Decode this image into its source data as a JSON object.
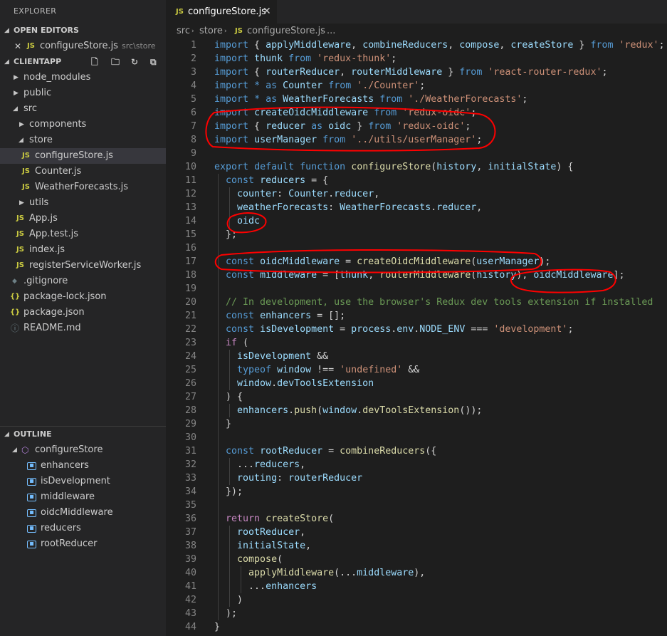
{
  "explorer": {
    "title": "EXPLORER",
    "open_editors": {
      "header": "OPEN EDITORS",
      "items": [
        {
          "close_glyph": "✕",
          "badge": "JS",
          "name": "configureStore.js",
          "path": "src\\store"
        }
      ]
    },
    "project": {
      "header": "CLIENTAPP",
      "tree": [
        {
          "label": "node_modules",
          "badge": ""
        },
        {
          "label": "public",
          "badge": ""
        },
        {
          "label": "src",
          "badge": ""
        },
        {
          "label": "components",
          "badge": ""
        },
        {
          "label": "store",
          "badge": ""
        },
        {
          "label": "configureStore.js",
          "badge": "JS"
        },
        {
          "label": "Counter.js",
          "badge": "JS"
        },
        {
          "label": "WeatherForecasts.js",
          "badge": "JS"
        },
        {
          "label": "utils",
          "badge": ""
        },
        {
          "label": "App.js",
          "badge": "JS"
        },
        {
          "label": "App.test.js",
          "badge": "JS"
        },
        {
          "label": "index.js",
          "badge": "JS"
        },
        {
          "label": "registerServiceWorker.js",
          "badge": "JS"
        },
        {
          "label": ".gitignore",
          "badge": "◆"
        },
        {
          "label": "package-lock.json",
          "badge": "{}"
        },
        {
          "label": "package.json",
          "badge": "{}"
        },
        {
          "label": "README.md",
          "badge": "ⓘ"
        }
      ]
    },
    "outline": {
      "header": "OUTLINE",
      "root": "configureStore",
      "items": [
        "enhancers",
        "isDevelopment",
        "middleware",
        "oidcMiddleware",
        "reducers",
        "rootReducer"
      ]
    }
  },
  "editor": {
    "tab": {
      "badge": "JS",
      "label": "configureStore.js",
      "close_glyph": "✕"
    },
    "breadcrumb": {
      "parts": [
        "src",
        "store",
        "configureStore.js",
        "..."
      ],
      "badge": "JS"
    },
    "code_lines": [
      [
        [
          "kw",
          "import"
        ],
        [
          "pl",
          " { "
        ],
        [
          "var",
          "applyMiddleware"
        ],
        [
          "pl",
          ", "
        ],
        [
          "var",
          "combineReducers"
        ],
        [
          "pl",
          ", "
        ],
        [
          "var",
          "compose"
        ],
        [
          "pl",
          ", "
        ],
        [
          "var",
          "createStore"
        ],
        [
          "pl",
          " } "
        ],
        [
          "kw",
          "from"
        ],
        [
          "pl",
          " "
        ],
        [
          "str",
          "'redux'"
        ],
        [
          "pl",
          ";"
        ]
      ],
      [
        [
          "kw",
          "import"
        ],
        [
          "pl",
          " "
        ],
        [
          "var",
          "thunk"
        ],
        [
          "pl",
          " "
        ],
        [
          "kw",
          "from"
        ],
        [
          "pl",
          " "
        ],
        [
          "str",
          "'redux-thunk'"
        ],
        [
          "pl",
          ";"
        ]
      ],
      [
        [
          "kw",
          "import"
        ],
        [
          "pl",
          " { "
        ],
        [
          "var",
          "routerReducer"
        ],
        [
          "pl",
          ", "
        ],
        [
          "var",
          "routerMiddleware"
        ],
        [
          "pl",
          " } "
        ],
        [
          "kw",
          "from"
        ],
        [
          "pl",
          " "
        ],
        [
          "str",
          "'react-router-redux'"
        ],
        [
          "pl",
          ";"
        ]
      ],
      [
        [
          "kw",
          "import"
        ],
        [
          "pl",
          " "
        ],
        [
          "kw",
          "*"
        ],
        [
          "pl",
          " "
        ],
        [
          "kw",
          "as"
        ],
        [
          "pl",
          " "
        ],
        [
          "var",
          "Counter"
        ],
        [
          "pl",
          " "
        ],
        [
          "kw",
          "from"
        ],
        [
          "pl",
          " "
        ],
        [
          "str",
          "'./Counter'"
        ],
        [
          "pl",
          ";"
        ]
      ],
      [
        [
          "kw",
          "import"
        ],
        [
          "pl",
          " "
        ],
        [
          "kw",
          "*"
        ],
        [
          "pl",
          " "
        ],
        [
          "kw",
          "as"
        ],
        [
          "pl",
          " "
        ],
        [
          "var",
          "WeatherForecasts"
        ],
        [
          "pl",
          " "
        ],
        [
          "kw",
          "from"
        ],
        [
          "pl",
          " "
        ],
        [
          "str",
          "'./WeatherForecasts'"
        ],
        [
          "pl",
          ";"
        ]
      ],
      [
        [
          "kw",
          "import"
        ],
        [
          "pl",
          " "
        ],
        [
          "var",
          "createOidcMiddleware"
        ],
        [
          "pl",
          " "
        ],
        [
          "kw",
          "from"
        ],
        [
          "pl",
          " "
        ],
        [
          "str",
          "'redux-oidc'"
        ],
        [
          "pl",
          ";"
        ]
      ],
      [
        [
          "kw",
          "import"
        ],
        [
          "pl",
          " { "
        ],
        [
          "var",
          "reducer"
        ],
        [
          "pl",
          " "
        ],
        [
          "kw",
          "as"
        ],
        [
          "pl",
          " "
        ],
        [
          "var",
          "oidc"
        ],
        [
          "pl",
          " } "
        ],
        [
          "kw",
          "from"
        ],
        [
          "pl",
          " "
        ],
        [
          "str",
          "'redux-oidc'"
        ],
        [
          "pl",
          ";"
        ]
      ],
      [
        [
          "kw",
          "import"
        ],
        [
          "pl",
          " "
        ],
        [
          "var",
          "userManager"
        ],
        [
          "pl",
          " "
        ],
        [
          "kw",
          "from"
        ],
        [
          "pl",
          " "
        ],
        [
          "str",
          "'../utils/userManager'"
        ],
        [
          "pl",
          ";"
        ]
      ],
      [],
      [
        [
          "kw",
          "export"
        ],
        [
          "pl",
          " "
        ],
        [
          "kw",
          "default"
        ],
        [
          "pl",
          " "
        ],
        [
          "kw",
          "function"
        ],
        [
          "pl",
          " "
        ],
        [
          "fn",
          "configureStore"
        ],
        [
          "pl",
          "("
        ],
        [
          "var",
          "history"
        ],
        [
          "pl",
          ", "
        ],
        [
          "var",
          "initialState"
        ],
        [
          "pl",
          ") {"
        ]
      ],
      [
        [
          "pl",
          "  "
        ],
        [
          "kw",
          "const"
        ],
        [
          "pl",
          " "
        ],
        [
          "var",
          "reducers"
        ],
        [
          "pl",
          " = {"
        ]
      ],
      [
        [
          "pl",
          "    "
        ],
        [
          "var",
          "counter"
        ],
        [
          "pl",
          ": "
        ],
        [
          "var",
          "Counter"
        ],
        [
          "pl",
          "."
        ],
        [
          "var",
          "reducer"
        ],
        [
          "pl",
          ","
        ]
      ],
      [
        [
          "pl",
          "    "
        ],
        [
          "var",
          "weatherForecasts"
        ],
        [
          "pl",
          ": "
        ],
        [
          "var",
          "WeatherForecasts"
        ],
        [
          "pl",
          "."
        ],
        [
          "var",
          "reducer"
        ],
        [
          "pl",
          ","
        ]
      ],
      [
        [
          "pl",
          "    "
        ],
        [
          "var",
          "oidc"
        ]
      ],
      [
        [
          "pl",
          "  };"
        ]
      ],
      [],
      [
        [
          "pl",
          "  "
        ],
        [
          "kw",
          "const"
        ],
        [
          "pl",
          " "
        ],
        [
          "var",
          "oidcMiddleware"
        ],
        [
          "pl",
          " = "
        ],
        [
          "fn",
          "createOidcMiddleware"
        ],
        [
          "pl",
          "("
        ],
        [
          "var",
          "userManager"
        ],
        [
          "pl",
          ");"
        ]
      ],
      [
        [
          "pl",
          "  "
        ],
        [
          "kw",
          "const"
        ],
        [
          "pl",
          " "
        ],
        [
          "var",
          "middleware"
        ],
        [
          "pl",
          " = ["
        ],
        [
          "var",
          "thunk"
        ],
        [
          "pl",
          ", "
        ],
        [
          "fn",
          "routerMiddleware"
        ],
        [
          "pl",
          "("
        ],
        [
          "var",
          "history"
        ],
        [
          "pl",
          "), "
        ],
        [
          "var",
          "oidcMiddleware"
        ],
        [
          "pl",
          "];"
        ]
      ],
      [],
      [
        [
          "pl",
          "  "
        ],
        [
          "cmt",
          "// In development, use the browser's Redux dev tools extension if installed"
        ]
      ],
      [
        [
          "pl",
          "  "
        ],
        [
          "kw",
          "const"
        ],
        [
          "pl",
          " "
        ],
        [
          "var",
          "enhancers"
        ],
        [
          "pl",
          " = [];"
        ]
      ],
      [
        [
          "pl",
          "  "
        ],
        [
          "kw",
          "const"
        ],
        [
          "pl",
          " "
        ],
        [
          "var",
          "isDevelopment"
        ],
        [
          "pl",
          " = "
        ],
        [
          "var",
          "process"
        ],
        [
          "pl",
          "."
        ],
        [
          "var",
          "env"
        ],
        [
          "pl",
          "."
        ],
        [
          "var",
          "NODE_ENV"
        ],
        [
          "pl",
          " === "
        ],
        [
          "str",
          "'development'"
        ],
        [
          "pl",
          ";"
        ]
      ],
      [
        [
          "pl",
          "  "
        ],
        [
          "ctl",
          "if"
        ],
        [
          "pl",
          " ("
        ]
      ],
      [
        [
          "pl",
          "    "
        ],
        [
          "var",
          "isDevelopment"
        ],
        [
          "pl",
          " &&"
        ]
      ],
      [
        [
          "pl",
          "    "
        ],
        [
          "kw",
          "typeof"
        ],
        [
          "pl",
          " "
        ],
        [
          "var",
          "window"
        ],
        [
          "pl",
          " !== "
        ],
        [
          "str",
          "'undefined'"
        ],
        [
          "pl",
          " &&"
        ]
      ],
      [
        [
          "pl",
          "    "
        ],
        [
          "var",
          "window"
        ],
        [
          "pl",
          "."
        ],
        [
          "var",
          "devToolsExtension"
        ]
      ],
      [
        [
          "pl",
          "  ) {"
        ]
      ],
      [
        [
          "pl",
          "    "
        ],
        [
          "var",
          "enhancers"
        ],
        [
          "pl",
          "."
        ],
        [
          "fn",
          "push"
        ],
        [
          "pl",
          "("
        ],
        [
          "var",
          "window"
        ],
        [
          "pl",
          "."
        ],
        [
          "fn",
          "devToolsExtension"
        ],
        [
          "pl",
          "());"
        ]
      ],
      [
        [
          "pl",
          "  }"
        ]
      ],
      [],
      [
        [
          "pl",
          "  "
        ],
        [
          "kw",
          "const"
        ],
        [
          "pl",
          " "
        ],
        [
          "var",
          "rootReducer"
        ],
        [
          "pl",
          " = "
        ],
        [
          "fn",
          "combineReducers"
        ],
        [
          "pl",
          "({"
        ]
      ],
      [
        [
          "pl",
          "    ..."
        ],
        [
          "var",
          "reducers"
        ],
        [
          "pl",
          ","
        ]
      ],
      [
        [
          "pl",
          "    "
        ],
        [
          "var",
          "routing"
        ],
        [
          "pl",
          ": "
        ],
        [
          "var",
          "routerReducer"
        ]
      ],
      [
        [
          "pl",
          "  });"
        ]
      ],
      [],
      [
        [
          "pl",
          "  "
        ],
        [
          "ctl",
          "return"
        ],
        [
          "pl",
          " "
        ],
        [
          "fn",
          "createStore"
        ],
        [
          "pl",
          "("
        ]
      ],
      [
        [
          "pl",
          "    "
        ],
        [
          "var",
          "rootReducer"
        ],
        [
          "pl",
          ","
        ]
      ],
      [
        [
          "pl",
          "    "
        ],
        [
          "var",
          "initialState"
        ],
        [
          "pl",
          ","
        ]
      ],
      [
        [
          "pl",
          "    "
        ],
        [
          "fn",
          "compose"
        ],
        [
          "pl",
          "("
        ]
      ],
      [
        [
          "pl",
          "      "
        ],
        [
          "fn",
          "applyMiddleware"
        ],
        [
          "pl",
          "(..."
        ],
        [
          "var",
          "middleware"
        ],
        [
          "pl",
          "),"
        ]
      ],
      [
        [
          "pl",
          "      ..."
        ],
        [
          "var",
          "enhancers"
        ]
      ],
      [
        [
          "pl",
          "    )"
        ]
      ],
      [
        [
          "pl",
          "  );"
        ]
      ],
      [
        [
          "pl",
          "}"
        ]
      ]
    ]
  },
  "colors": {
    "annotation": "#ff0000",
    "sidebar_bg": "#252526",
    "editor_bg": "#1e1e1e"
  }
}
